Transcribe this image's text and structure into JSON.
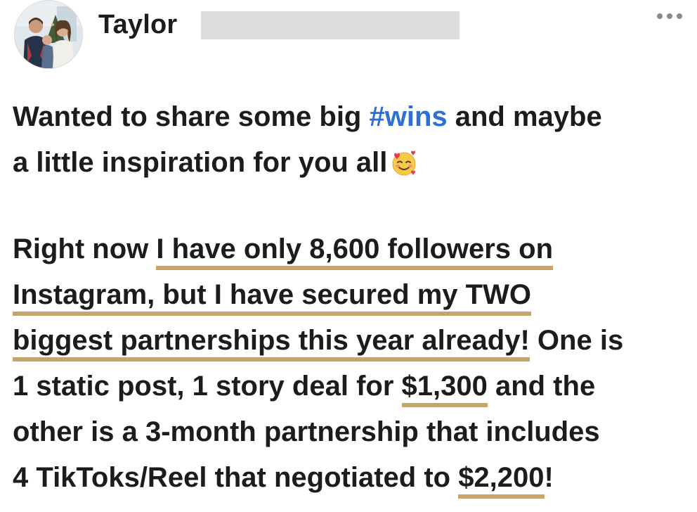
{
  "post": {
    "author": {
      "name": "Taylor",
      "avatar_icon": "family-photo-avatar"
    },
    "more_icon": "ellipsis-icon",
    "text": {
      "line1_a": "Wanted to share some big ",
      "hashtag": "#wins",
      "line1_b": " and maybe",
      "line2": "a little inspiration for you all",
      "emoji_icon": "smiling-face-with-hearts-icon",
      "line3_a": "Right now ",
      "line3_u": "I have only 8,600 followers on",
      "line4_u": "Instagram, but I have secured my TWO",
      "line5_u": "biggest partnerships this year already!",
      "line5_b": " One is",
      "line6_a": "1 static post, 1 story deal for ",
      "line6_u": "$1,300",
      "line6_b": " and the",
      "line7": "other is a 3-month partnership that includes",
      "line8_a": "4 TikToks/Reel that negotiated to ",
      "line8_u": "$2,200",
      "line8_b": "!"
    },
    "colors": {
      "hashtag": "#2f6fd3",
      "underline": "#c8a36a",
      "redaction": "#dcdcdc"
    }
  }
}
